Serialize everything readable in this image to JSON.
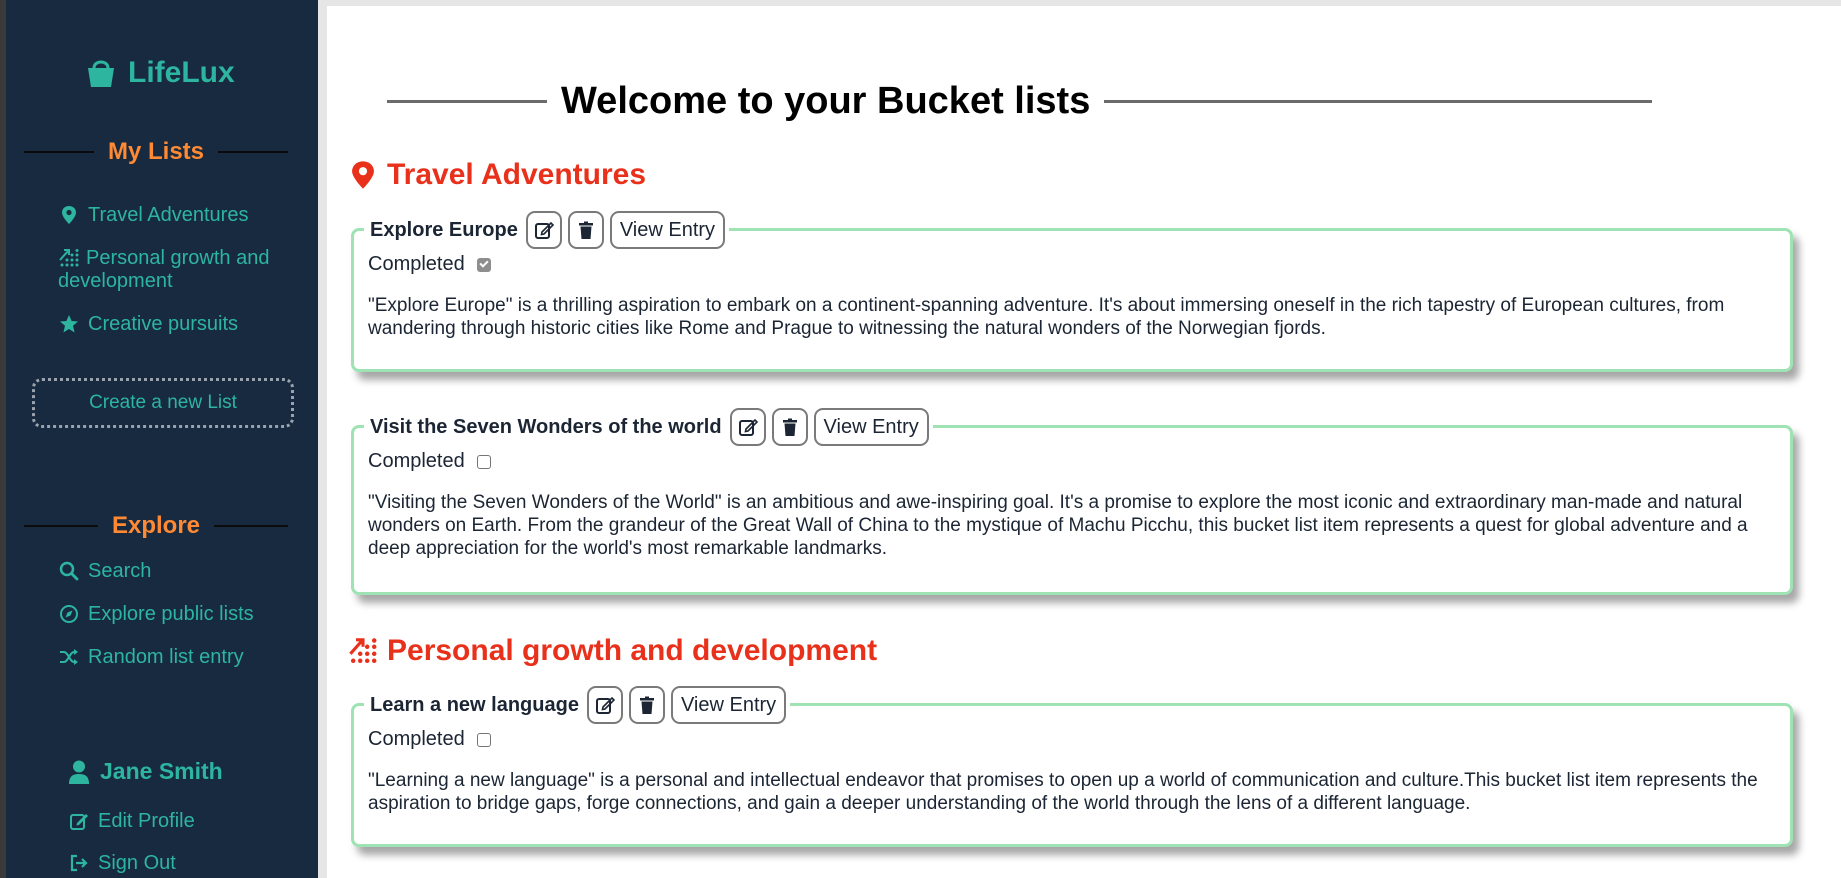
{
  "sidebar": {
    "brand": "LifeLux",
    "my_lists_heading": "My Lists",
    "lists": [
      {
        "label": "Travel Adventures",
        "icon": "map-pin-icon"
      },
      {
        "label": "Personal growth and development",
        "icon": "growth-chart-icon"
      },
      {
        "label": "Creative pursuits",
        "icon": "star-icon"
      }
    ],
    "create_button": "Create a new List",
    "explore_heading": "Explore",
    "explore": [
      {
        "label": "Search",
        "icon": "search-icon"
      },
      {
        "label": "Explore public lists",
        "icon": "compass-icon"
      },
      {
        "label": "Random list entry",
        "icon": "shuffle-icon"
      }
    ],
    "user_name": "Jane Smith",
    "edit_profile": "Edit Profile",
    "sign_out": "Sign Out"
  },
  "main": {
    "title": "Welcome to your Bucket lists",
    "lists": [
      {
        "title": "Travel Adventures",
        "entries": [
          {
            "name": "Explore Europe",
            "completed_label": "Completed",
            "completed": true,
            "view_label": "View Entry",
            "description": "\"Explore Europe\" is a thrilling aspiration to embark on a continent-spanning adventure. It's about immersing oneself in the rich tapestry of European cultures, from wandering through historic cities like Rome and Prague to witnessing the natural wonders of the Norwegian fjords."
          },
          {
            "name": "Visit the Seven Wonders of the world",
            "completed_label": "Completed",
            "completed": false,
            "view_label": "View Entry",
            "description": "\"Visiting the Seven Wonders of the World\" is an ambitious and awe-inspiring goal. It's a promise to explore the most iconic and extraordinary man-made and natural wonders on Earth. From the grandeur of the Great Wall of China to the mystique of Machu Picchu, this bucket list item represents a quest for global adventure and a deep appreciation for the world's most remarkable landmarks."
          }
        ]
      },
      {
        "title": "Personal growth and development",
        "entries": [
          {
            "name": "Learn a new language",
            "completed_label": "Completed",
            "completed": false,
            "view_label": "View Entry",
            "description": "\"Learning a new language\" is a personal and intellectual endeavor that promises to open up a world of communication and culture.This bucket list item represents the aspiration to bridge gaps, forge connections, and gain a deeper understanding of the world through the lens of a different language."
          }
        ]
      }
    ]
  },
  "colors": {
    "sidebar_bg": "#172a40",
    "accent_teal": "#2db5a0",
    "heading_orange": "#ff8a33",
    "list_title_red": "#e8301b",
    "card_border_green": "#9fe3b4"
  }
}
